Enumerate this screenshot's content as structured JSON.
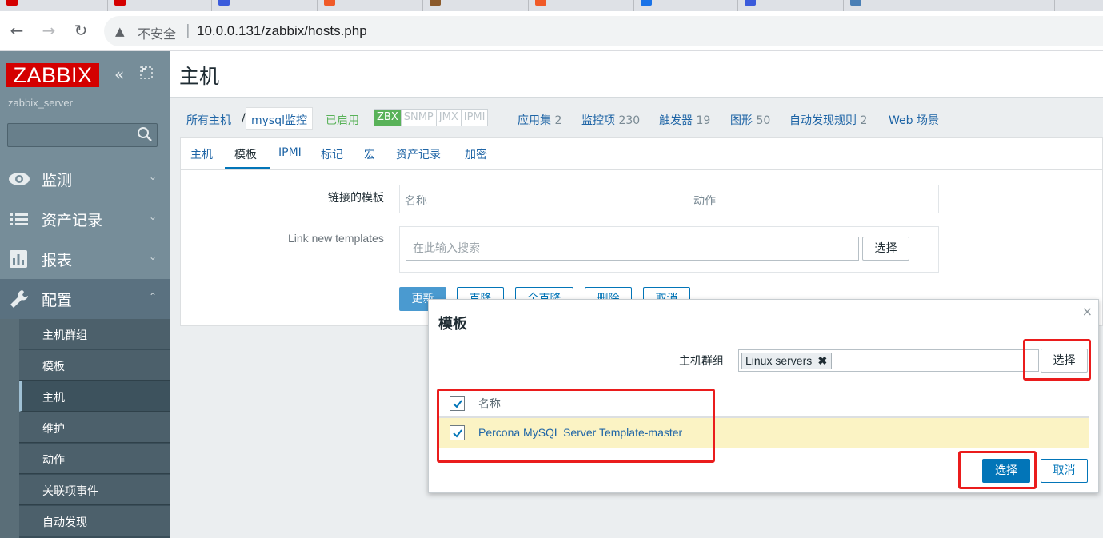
{
  "browser": {
    "insecure_label": "不安全",
    "separator": "|",
    "url": "10.0.0.131/zabbix/hosts.php"
  },
  "sidebar": {
    "logo": "ZABBIX",
    "server_name": "zabbix_server",
    "menu": [
      {
        "label": "监测",
        "icon": "eye-icon"
      },
      {
        "label": "资产记录",
        "icon": "list-icon"
      },
      {
        "label": "报表",
        "icon": "bar-chart-icon"
      },
      {
        "label": "配置",
        "icon": "wrench-icon"
      }
    ],
    "submenu": [
      "主机群组",
      "模板",
      "主机",
      "维护",
      "动作",
      "关联项事件",
      "自动发现"
    ],
    "current_submenu": "主机"
  },
  "page": {
    "title": "主机"
  },
  "host_nav": {
    "all_hosts": "所有主机",
    "slash": "/",
    "host": "mysql监控",
    "enabled": "已启用",
    "availability": [
      "ZBX",
      "SNMP",
      "JMX",
      "IPMI"
    ],
    "applications": "应用集",
    "applications_count": "2",
    "items": "监控项",
    "items_count": "230",
    "triggers": "触发器",
    "triggers_count": "19",
    "graphs": "图形",
    "graphs_count": "50",
    "discovery": "自动发现规则",
    "discovery_count": "2",
    "web": "Web 场景"
  },
  "form": {
    "tabs": [
      "主机",
      "模板",
      "IPMI",
      "标记",
      "宏",
      "资产记录",
      "加密"
    ],
    "active_tab": "模板",
    "linked_templates_label": "链接的模板",
    "col_name": "名称",
    "col_action": "动作",
    "link_new_label": "Link new templates",
    "search_placeholder": "在此输入搜索",
    "select_button": "选择",
    "buttons": [
      "更新",
      "克隆",
      "全克隆",
      "删除",
      "取消"
    ]
  },
  "modal": {
    "title": "模板",
    "close": "×",
    "host_group_label": "主机群组",
    "selected_group": "Linux servers",
    "select_button": "选择",
    "col_name": "名称",
    "rows": [
      {
        "name": "Percona MySQL Server Template-master",
        "checked": true
      }
    ],
    "header_checked": true,
    "confirm_button": "选择",
    "cancel_button": "取消"
  },
  "colors": {
    "brand_red": "#d40000",
    "sidebar": "#768d99",
    "link": "#1f65a6",
    "primary": "#0275b8",
    "enabled": "#59b259",
    "highlight": "#ea1c1c",
    "selected_row": "#fbf3c4"
  }
}
